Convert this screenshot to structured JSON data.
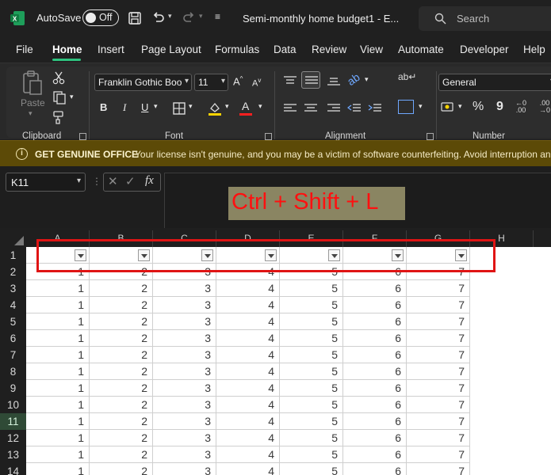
{
  "titlebar": {
    "autosave_label": "AutoSave",
    "autosave_state": "Off",
    "doc_title": "Semi-monthly home budget1  -  E...",
    "search_placeholder": "Search"
  },
  "tabs": [
    "File",
    "Home",
    "Insert",
    "Page Layout",
    "Formulas",
    "Data",
    "Review",
    "View",
    "Automate",
    "Developer",
    "Help"
  ],
  "active_tab": "Home",
  "ribbon": {
    "paste_label": "Paste",
    "font_name": "Franklin Gothic Boo",
    "font_size": "11",
    "number_format": "General",
    "groups": {
      "clipboard": "Clipboard",
      "font": "Font",
      "alignment": "Alignment",
      "number": "Number"
    },
    "bold": "B",
    "italic": "I",
    "underline": "U",
    "font_color_letter": "A",
    "percent": "%",
    "comma": "9"
  },
  "warning": {
    "title": "GET GENUINE OFFICE",
    "message": "Your license isn't genuine, and you may be a victim of software counterfeiting. Avoid interruption an"
  },
  "formula_bar": {
    "cell_ref": "K11",
    "fx": "fx",
    "overlay_text": "Ctrl + Shift + L"
  },
  "sheet": {
    "columns": [
      "A",
      "B",
      "C",
      "D",
      "E",
      "F",
      "G",
      "H"
    ],
    "rows": [
      "1",
      "2",
      "3",
      "4",
      "5",
      "6",
      "7",
      "8",
      "9",
      "10",
      "11",
      "12",
      "13",
      "14"
    ],
    "selected_row": "11",
    "row_values": [
      "1",
      "2",
      "3",
      "4",
      "5",
      "6",
      "7"
    ]
  },
  "colors": {
    "accent": "#2ec27e",
    "highlight": "#e01414",
    "warning_bg": "#5c4a07"
  }
}
